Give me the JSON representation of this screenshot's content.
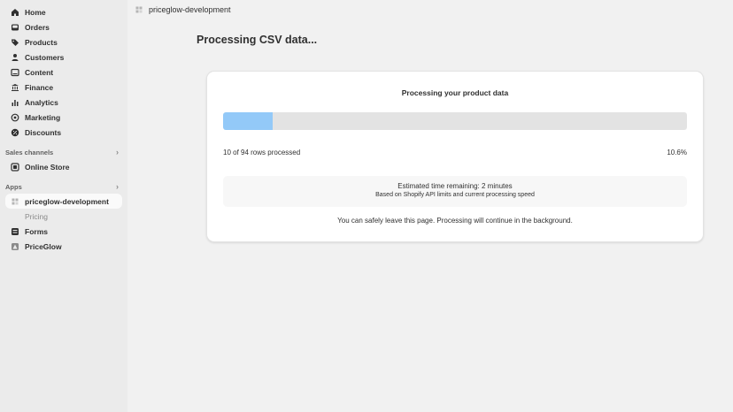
{
  "sidebar": {
    "items": [
      {
        "label": "Home",
        "icon": "home-icon"
      },
      {
        "label": "Orders",
        "icon": "inbox-icon"
      },
      {
        "label": "Products",
        "icon": "tag-icon"
      },
      {
        "label": "Customers",
        "icon": "person-icon"
      },
      {
        "label": "Content",
        "icon": "content-icon"
      },
      {
        "label": "Finance",
        "icon": "bank-icon"
      },
      {
        "label": "Analytics",
        "icon": "bar-chart-icon"
      },
      {
        "label": "Marketing",
        "icon": "target-icon"
      },
      {
        "label": "Discounts",
        "icon": "discount-icon"
      }
    ],
    "sales_channels": {
      "heading": "Sales channels",
      "items": [
        {
          "label": "Online Store",
          "icon": "store-icon"
        }
      ]
    },
    "apps": {
      "heading": "Apps",
      "items": [
        {
          "label": "priceglow-development",
          "icon": "app-grid-icon",
          "active": true
        },
        {
          "label": "Pricing",
          "sub": true
        },
        {
          "label": "Forms",
          "icon": "forms-icon"
        },
        {
          "label": "PriceGlow",
          "icon": "priceglow-icon"
        }
      ]
    }
  },
  "topbar": {
    "app_name": "priceglow-development"
  },
  "page": {
    "title": "Processing CSV data..."
  },
  "card": {
    "title": "Processing your product data",
    "progress_fraction": 0.106,
    "rows_text": "10 of 94 rows processed",
    "percent_text": "10.6%",
    "estimate_main": "Estimated time remaining: 2 minutes",
    "estimate_sub": "Based on Shopify API limits and current processing speed",
    "leave_text": "You can safely leave this page. Processing will continue in the background."
  },
  "colors": {
    "progress_fill": "#93c9f8",
    "progress_track": "#e3e3e3",
    "sidebar_bg": "#ebebeb",
    "page_bg": "#f1f1f1"
  }
}
